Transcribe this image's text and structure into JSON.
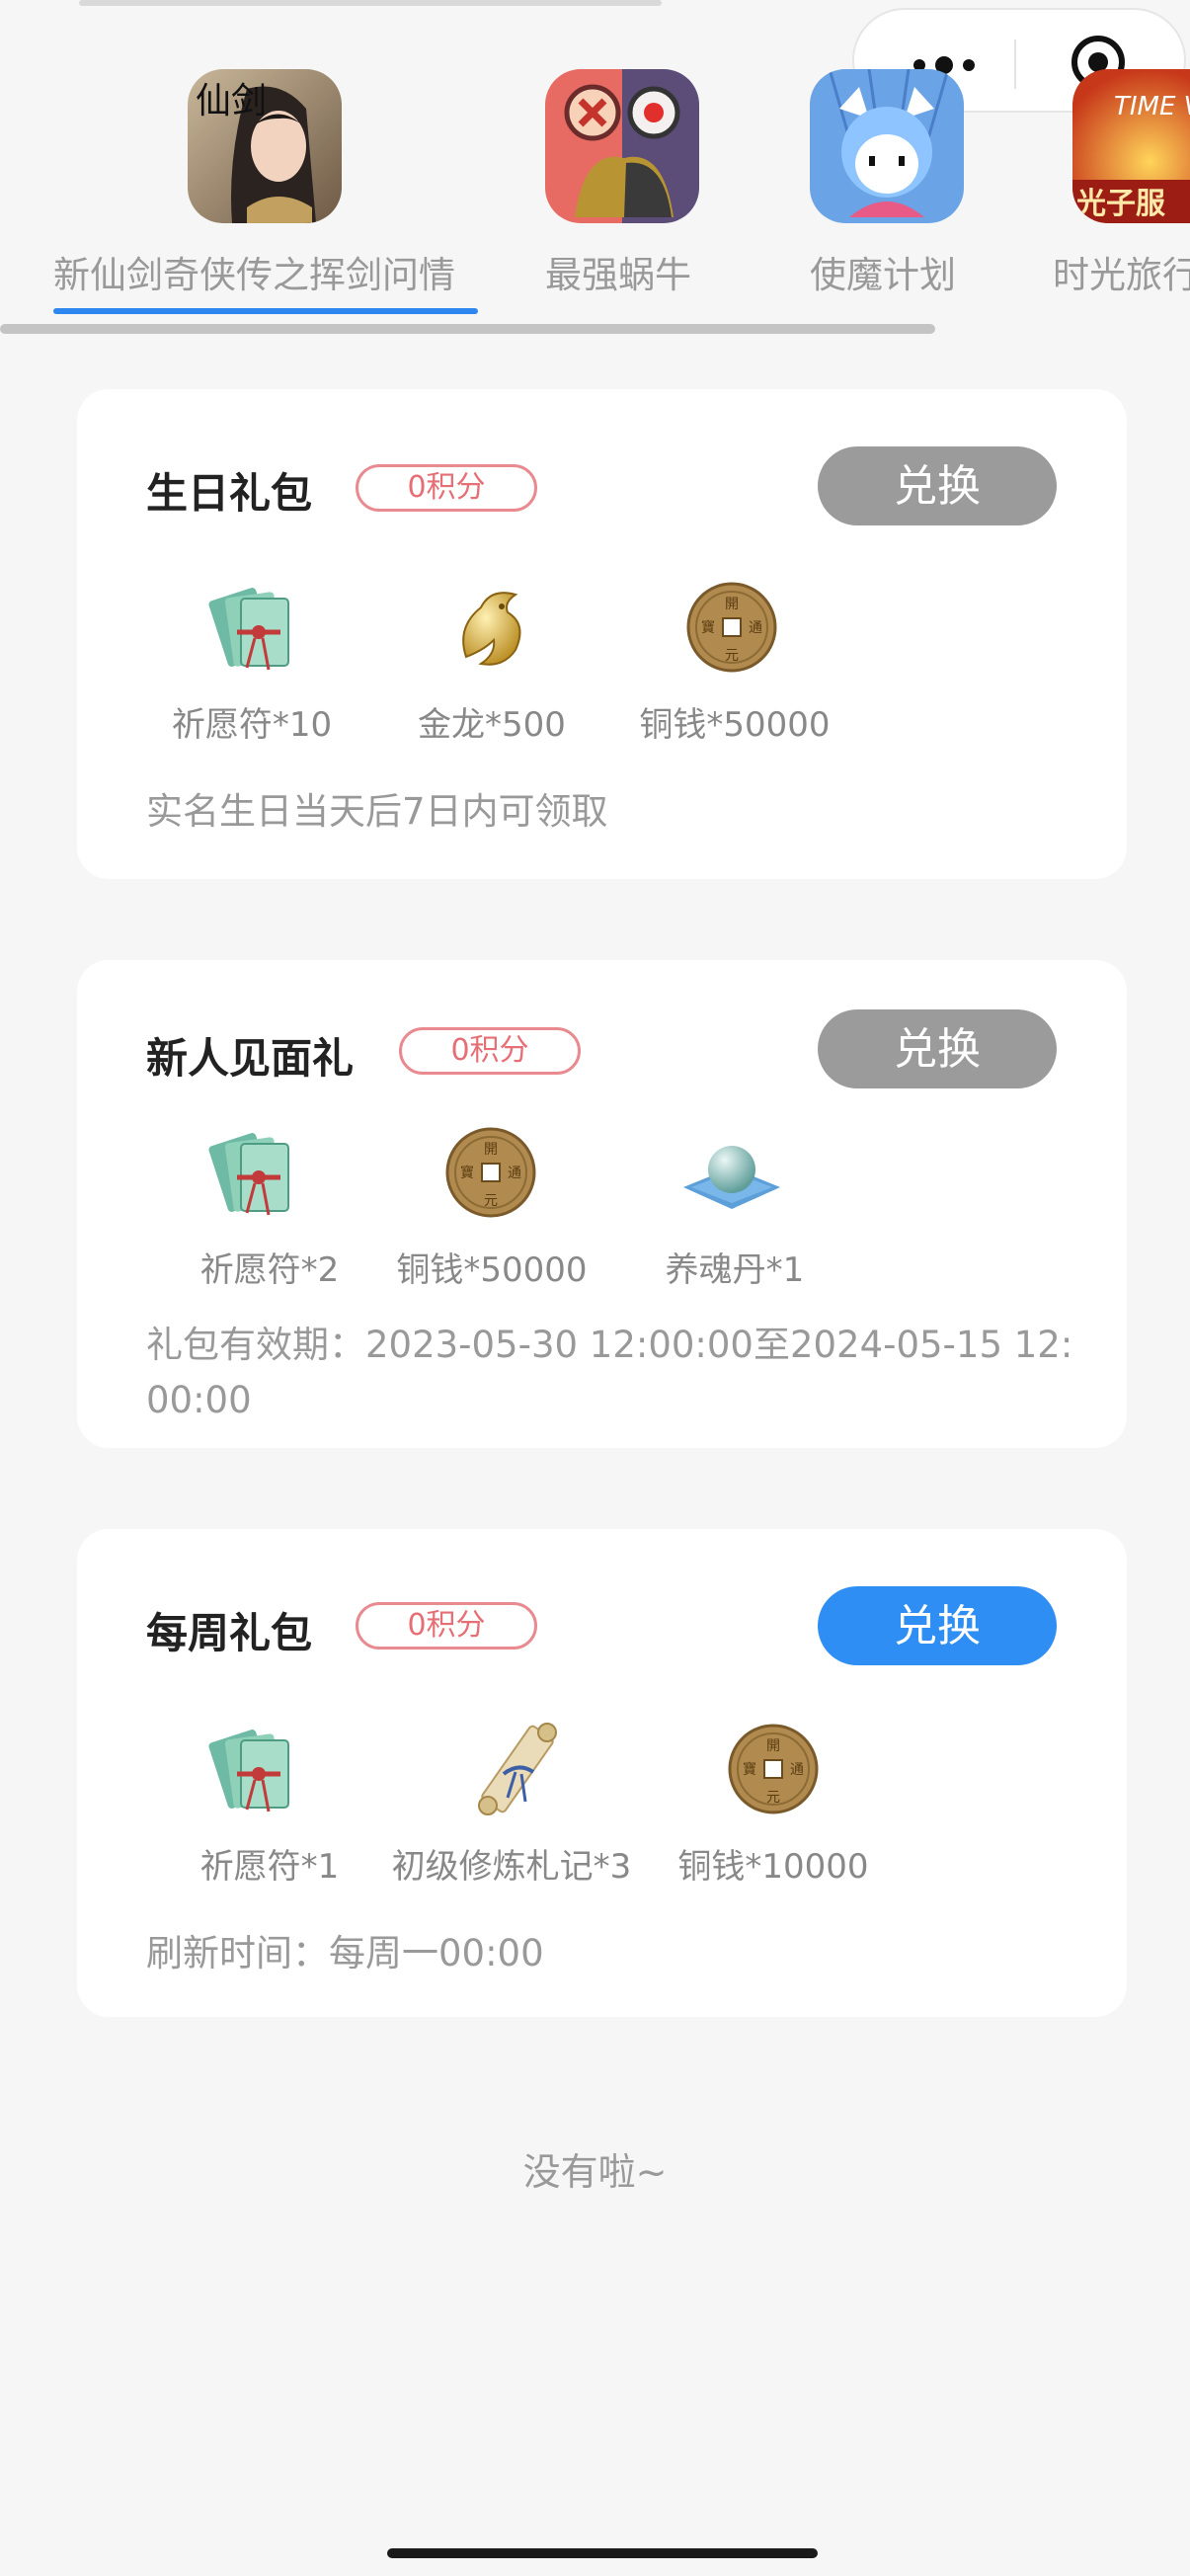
{
  "tabs": [
    {
      "label": "新仙剑奇侠传之挥剑问情",
      "icon": "xianjian-game-icon",
      "active": true
    },
    {
      "label": "最强蜗牛",
      "icon": "snail-game-icon",
      "active": false
    },
    {
      "label": "使魔计划",
      "icon": "shimo-game-icon",
      "active": false
    },
    {
      "label": "时光旅行",
      "icon": "time-voyager-game-icon",
      "active": false
    }
  ],
  "tab_icon_texts": {
    "xianjian": "仙剑",
    "timevoyager": "TIME VOYAGER",
    "guangzi": "光子服"
  },
  "cards": [
    {
      "title": "生日礼包",
      "points": "0积分",
      "button": "兑换",
      "button_state": "disabled",
      "rewards": [
        {
          "label": "祈愿符*10",
          "icon": "wish-talisman-icon"
        },
        {
          "label": "金龙*500",
          "icon": "golden-dragon-icon"
        },
        {
          "label": "铜钱*50000",
          "icon": "copper-coin-icon"
        }
      ],
      "note": "实名生日当天后7日内可领取"
    },
    {
      "title": "新人见面礼",
      "points": "0积分",
      "button": "兑换",
      "button_state": "disabled",
      "rewards": [
        {
          "label": "祈愿符*2",
          "icon": "wish-talisman-icon"
        },
        {
          "label": "铜钱*50000",
          "icon": "copper-coin-icon"
        },
        {
          "label": "养魂丹*1",
          "icon": "soul-pill-icon"
        }
      ],
      "note": "礼包有效期：2023-05-30 12:00:00至2024-05-15 12:00:00"
    },
    {
      "title": "每周礼包",
      "points": "0积分",
      "button": "兑换",
      "button_state": "enabled",
      "rewards": [
        {
          "label": "祈愿符*1",
          "icon": "wish-talisman-icon"
        },
        {
          "label": "初级修炼札记*3",
          "icon": "scroll-icon"
        },
        {
          "label": "铜钱*10000",
          "icon": "copper-coin-icon"
        }
      ],
      "note": "刷新时间：每周一00:00"
    }
  ],
  "coin_chars": [
    "開",
    "元",
    "通",
    "寶"
  ],
  "footer": "没有啦~",
  "colors": {
    "accent": "#2f8ef3",
    "disabled": "#9b9b9b",
    "points": "#e66f76"
  }
}
